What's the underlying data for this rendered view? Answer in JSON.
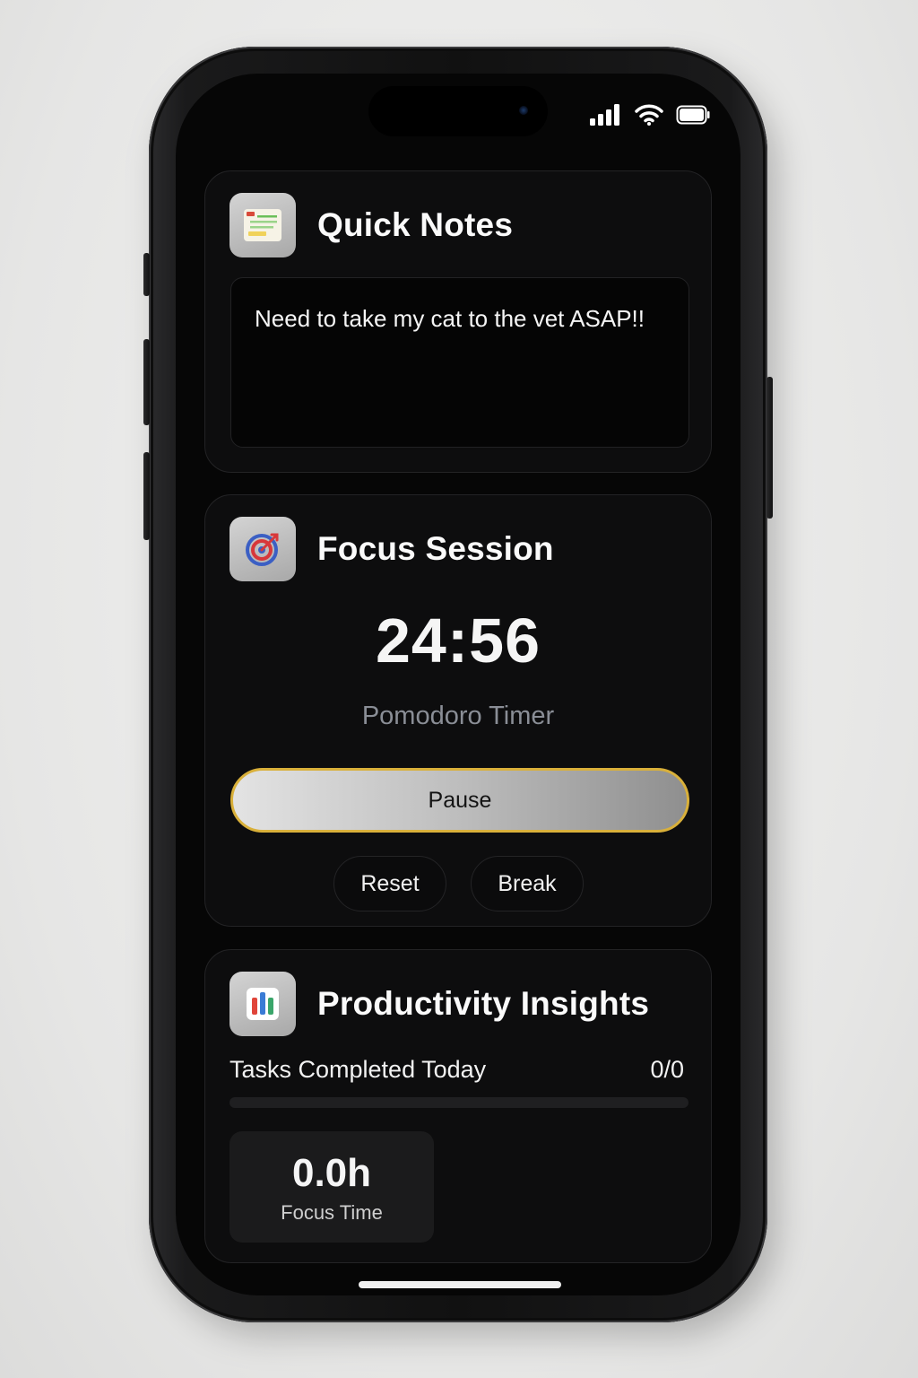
{
  "status_bar": {
    "signal_icon": "signal-bars-icon",
    "wifi_icon": "wifi-icon",
    "battery_icon": "battery-icon"
  },
  "quick_notes": {
    "icon": "notepad-icon",
    "title": "Quick Notes",
    "note_text": "Need to take my cat to the vet ASAP!!"
  },
  "focus_session": {
    "icon": "target-icon",
    "title": "Focus Session",
    "timer": "24:56",
    "timer_label": "Pomodoro Timer",
    "pause_label": "Pause",
    "reset_label": "Reset",
    "break_label": "Break",
    "accent_color": "#d9b03a"
  },
  "insights": {
    "icon": "bar-chart-icon",
    "title": "Productivity Insights",
    "tasks_label": "Tasks Completed Today",
    "tasks_value": "0/0",
    "tasks_progress": 0,
    "focus_value": "0.0h",
    "focus_label": "Focus Time"
  }
}
